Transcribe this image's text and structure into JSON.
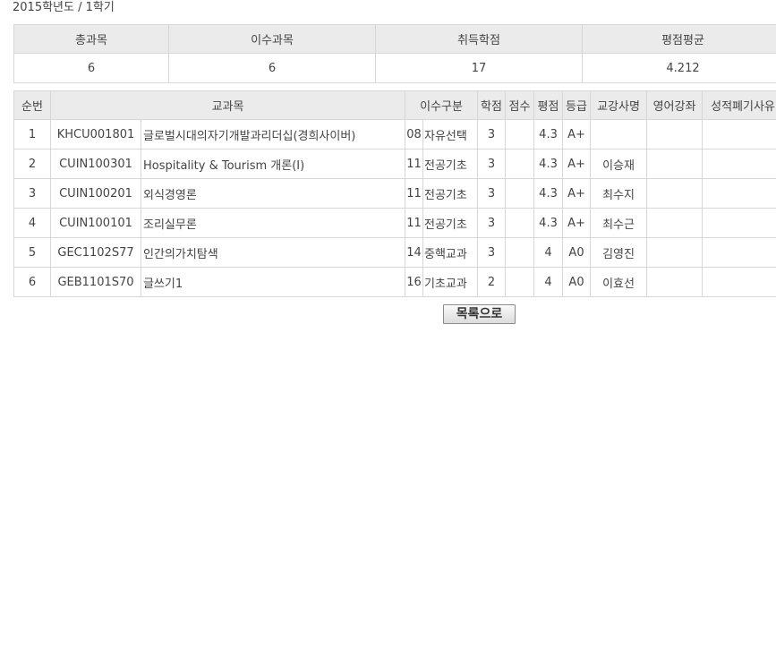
{
  "term": "2015학년도 / 1학기",
  "summary": {
    "headers": [
      "총과목",
      "이수과목",
      "취득학점",
      "평점평균"
    ],
    "values": [
      "6",
      "6",
      "17",
      "4.212"
    ]
  },
  "courses": {
    "headers": {
      "no": "순번",
      "course": "교과목",
      "category": "이수구분",
      "credit": "학점",
      "score": "점수",
      "gpa": "평점",
      "grade": "등급",
      "professor": "교강사명",
      "english": "영어강좌",
      "dropped": "성적폐기사유"
    },
    "rows": [
      {
        "no": "1",
        "code": "KHCU001801",
        "name": "글로벌시대의자기개발과리더십(경희사이버)",
        "cat_code": "08",
        "cat_name": "자유선택",
        "credit": "3",
        "score": "",
        "gpa": "4.3",
        "grade": "A+",
        "professor": "",
        "english": "",
        "dropped": ""
      },
      {
        "no": "2",
        "code": "CUIN100301",
        "name": "Hospitality & Tourism 개론(I)",
        "cat_code": "11",
        "cat_name": "전공기초",
        "credit": "3",
        "score": "",
        "gpa": "4.3",
        "grade": "A+",
        "professor": "이승재",
        "english": "",
        "dropped": ""
      },
      {
        "no": "3",
        "code": "CUIN100201",
        "name": "외식경영론",
        "cat_code": "11",
        "cat_name": "전공기초",
        "credit": "3",
        "score": "",
        "gpa": "4.3",
        "grade": "A+",
        "professor": "최수지",
        "english": "",
        "dropped": ""
      },
      {
        "no": "4",
        "code": "CUIN100101",
        "name": "조리실무론",
        "cat_code": "11",
        "cat_name": "전공기초",
        "credit": "3",
        "score": "",
        "gpa": "4.3",
        "grade": "A+",
        "professor": "최수근",
        "english": "",
        "dropped": ""
      },
      {
        "no": "5",
        "code": "GEC1102S77",
        "name": "인간의가치탐색",
        "cat_code": "14",
        "cat_name": "중핵교과",
        "credit": "3",
        "score": "",
        "gpa": "4",
        "grade": "A0",
        "professor": "김영진",
        "english": "",
        "dropped": ""
      },
      {
        "no": "6",
        "code": "GEB1101S70",
        "name": "글쓰기1",
        "cat_code": "16",
        "cat_name": "기초교과",
        "credit": "2",
        "score": "",
        "gpa": "4",
        "grade": "A0",
        "professor": "이효선",
        "english": "",
        "dropped": ""
      }
    ]
  },
  "back_button_label": "목록으로"
}
